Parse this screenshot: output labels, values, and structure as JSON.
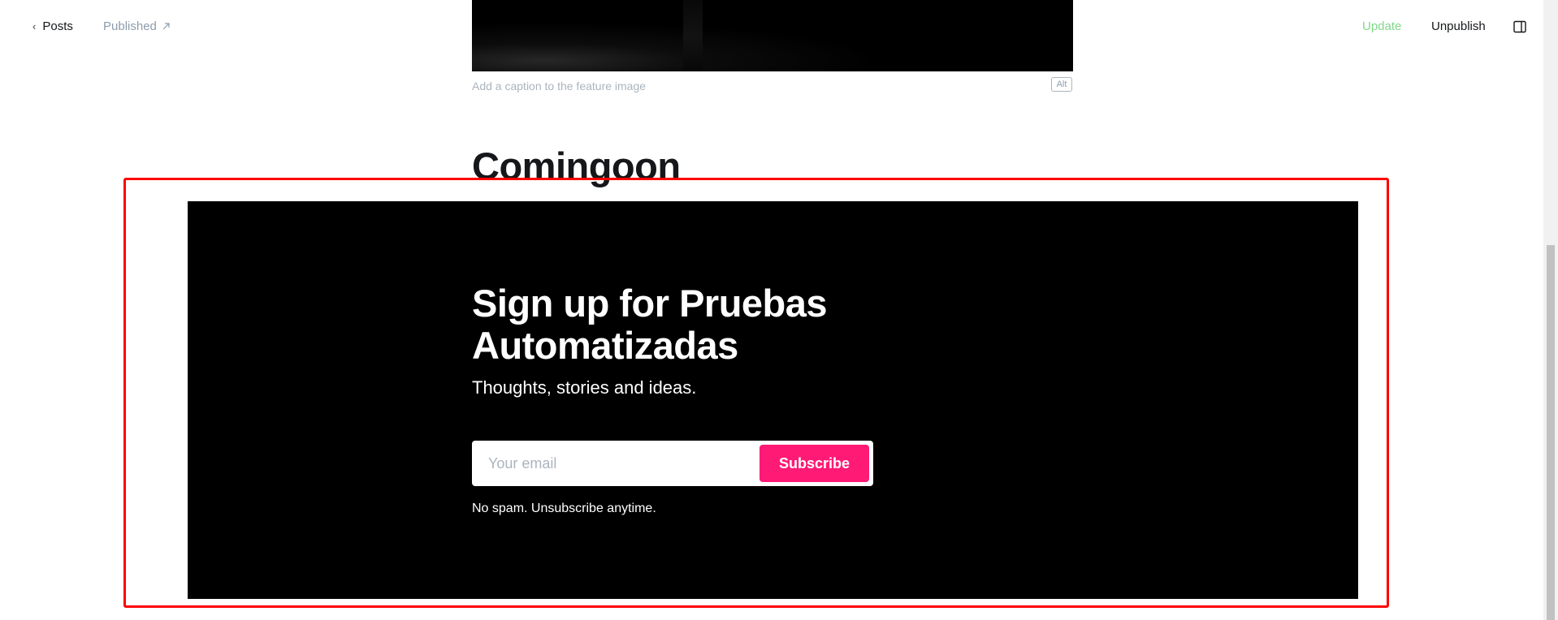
{
  "topbar": {
    "back_label": "Posts",
    "status_label": "Published",
    "update_label": "Update",
    "unpublish_label": "Unpublish"
  },
  "feature_image": {
    "caption_placeholder": "Add a caption to the feature image",
    "alt_label": "Alt"
  },
  "post": {
    "title": "Comingoon"
  },
  "signup": {
    "heading": "Sign up for Pruebas Automatizadas",
    "description": "Thoughts, stories and ideas.",
    "email_placeholder": "Your email",
    "subscribe_label": "Subscribe",
    "note": "No spam. Unsubscribe anytime."
  },
  "colors": {
    "accent": "#ff1a75",
    "update_green": "#80d78a",
    "highlight_red": "#ff0000"
  }
}
